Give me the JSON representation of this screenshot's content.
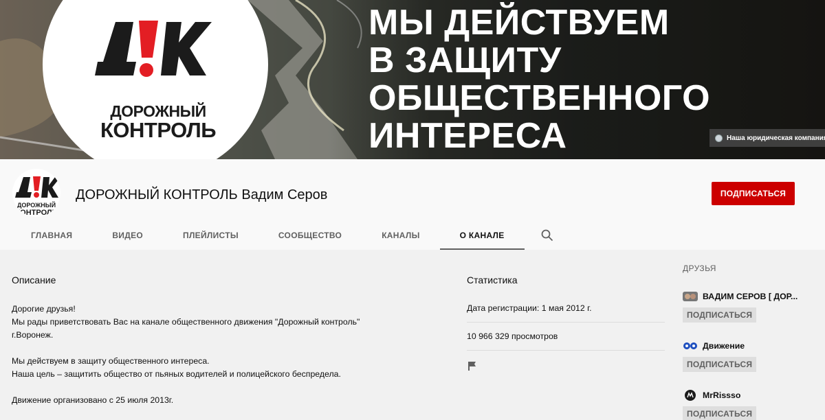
{
  "banner": {
    "logo_line1": "ДОРОЖНЫЙ",
    "logo_line2": "КОНТРОЛЬ",
    "slogan": [
      "МЫ ДЕЙСТВУЕМ",
      "В ЗАЩИТУ",
      "ОБЩЕСТВЕННОГО",
      "ИНТЕРЕСА"
    ],
    "link_label": "Наша юридическая компания"
  },
  "channel": {
    "title": "ДОРОЖНЫЙ КОНТРОЛЬ Вадим Серов",
    "avatar_line1": "ДОРОЖНЫЙ",
    "avatar_line2": "КОНТРОЛЬ",
    "subscribe_label": "ПОДПИСАТЬСЯ"
  },
  "tabs": [
    "ГЛАВНАЯ",
    "ВИДЕО",
    "ПЛЕЙЛИСТЫ",
    "СООБЩЕСТВО",
    "КАНАЛЫ",
    "О КАНАЛЕ"
  ],
  "description": {
    "title": "Описание",
    "lines": [
      "Дорогие друзья!",
      "Мы рады приветствовать Вас на канале общественного движения \"Дорожный контроль\"",
      "г.Воронеж.",
      "",
      "Мы действуем в защиту общественного интереса.",
      "Наша цель – защитить общество от пьяных водителей и полицейского беспредела.",
      "",
      "Движение организовано с 25 июля 2013г."
    ]
  },
  "stats": {
    "title": "Статистика",
    "registered": "Дата регистрации: 1 мая 2012 г.",
    "views": "10 966 329 просмотров"
  },
  "friends": {
    "title": "ДРУЗЬЯ",
    "items": [
      {
        "name": "ВАДИМ СЕРОВ [ ДОР...",
        "subscribe_label": "ПОДПИСАТЬСЯ"
      },
      {
        "name": "Движение",
        "subscribe_label": "ПОДПИСАТЬСЯ"
      },
      {
        "name": "MrRissso",
        "subscribe_label": "ПОДПИСАТЬСЯ"
      }
    ]
  },
  "colors": {
    "accent": "#cc0000",
    "logo_black": "#1b1b1b",
    "logo_red": "#e31e24"
  }
}
